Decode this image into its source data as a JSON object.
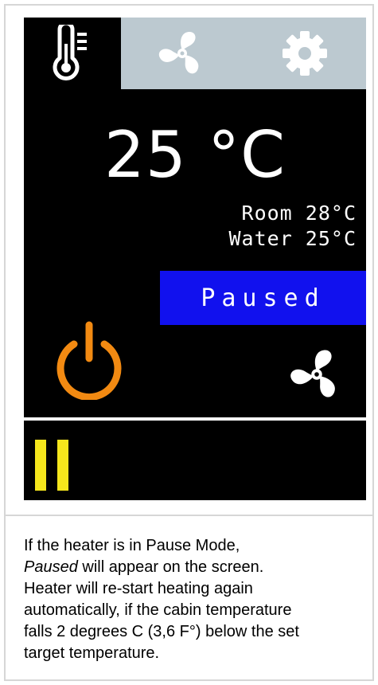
{
  "tabs": [
    {
      "name": "temperature",
      "icon": "thermometer-icon",
      "active": true
    },
    {
      "name": "fan",
      "icon": "fan-icon",
      "active": false
    },
    {
      "name": "settings",
      "icon": "gear-icon",
      "active": false
    }
  ],
  "setpoint": {
    "value": "25 °C"
  },
  "readings": {
    "room": "Room 28°C",
    "water": "Water 25°C"
  },
  "status": {
    "label": "Paused"
  },
  "controls": {
    "power_icon": "power-icon",
    "fan_icon": "fan-icon",
    "pause_icon": "pause-icon"
  },
  "colors": {
    "screen_bg": "#000000",
    "tab_inactive_bg": "#bcc9d0",
    "status_bg": "#1111ee",
    "power_accent": "#f28a12",
    "pause_accent": "#f5e61c"
  },
  "caption": {
    "line1": "If the heater is in Pause Mode,",
    "line2_italic": "Paused",
    "line2_rest": " will appear on the screen.",
    "line3": "Heater will re-start heating again",
    "line4": "automatically, if the cabin temperature",
    "line5": "falls 2 degrees C (3,6 F°) below the set",
    "line6": "target temperature."
  }
}
